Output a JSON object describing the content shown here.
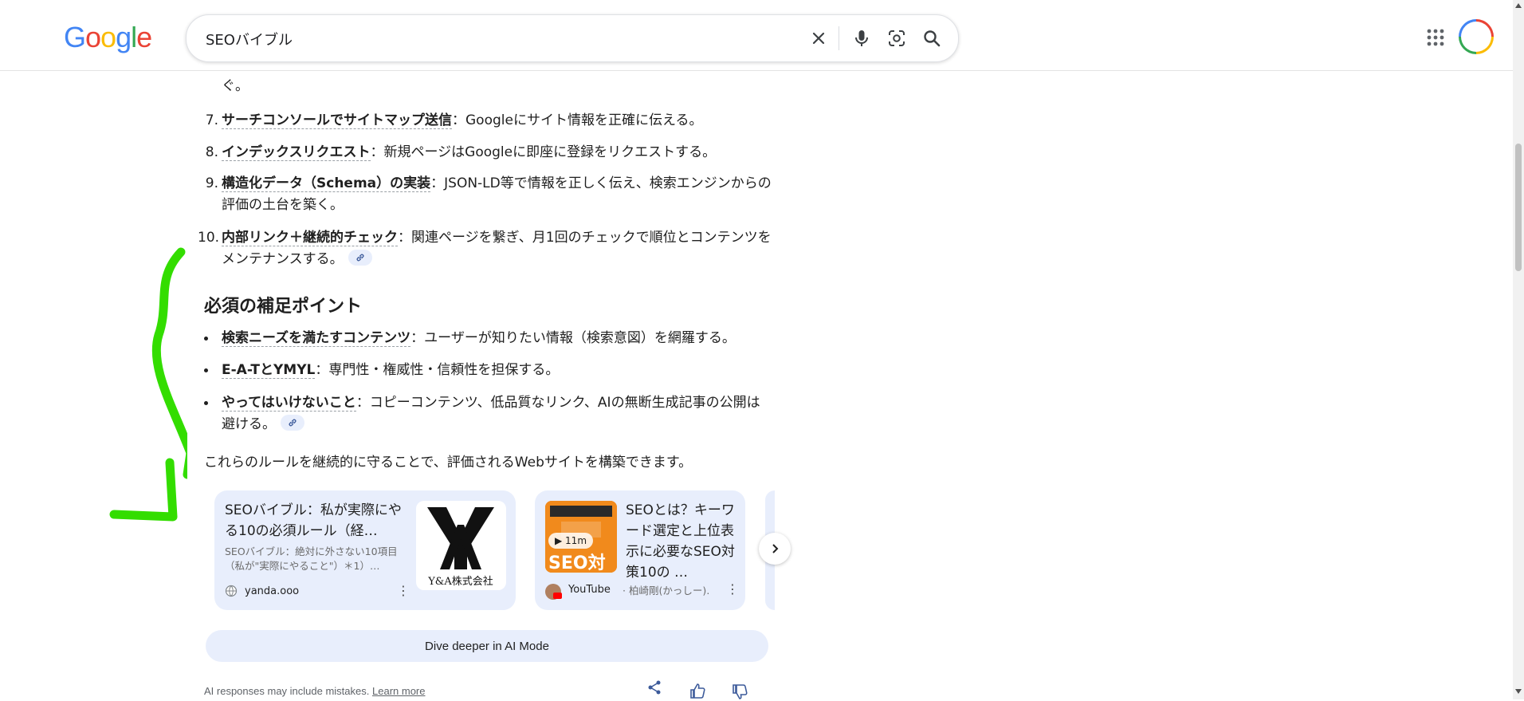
{
  "search": {
    "query": "SEOバイブル"
  },
  "logo": {
    "text": "Google",
    "colors": [
      "#4285f4",
      "#ea4335",
      "#fbbc05",
      "#4285f4",
      "#34a853",
      "#ea4335"
    ]
  },
  "list": {
    "clipped_line": "ぐ。",
    "items": [
      {
        "num": "7.",
        "bold": "サーチコンソールでサイトマップ送信",
        "text": "：Googleにサイト情報を正確に伝える。"
      },
      {
        "num": "8.",
        "bold": "インデックスリクエスト",
        "text": "：新規ページはGoogleに即座に登録をリクエストする。"
      },
      {
        "num": "9.",
        "bold": "構造化データ（Schema）の実装",
        "text": "：JSON-LD等で情報を正しく伝え、検索エンジンからの評価の土台を築く。"
      },
      {
        "num": "10.",
        "bold": "内部リンク＋継続的チェック",
        "text": "：関連ページを繋ぎ、月1回のチェックで順位とコンテンツをメンテナンスする。"
      }
    ]
  },
  "section": {
    "heading": "必須の補足ポイント",
    "bullets": [
      {
        "bold": "検索ニーズを満たすコンテンツ",
        "text": "：ユーザーが知りたい情報（検索意図）を網羅する。"
      },
      {
        "bold": "E-A-TとYMYL",
        "text": "：専門性・権威性・信頼性を担保する。"
      },
      {
        "bold": "やってはいけないこと",
        "text": "：コピーコンテンツ、低品質なリンク、AIの無断生成記事の公開は避ける。"
      }
    ],
    "summary": "これらのルールを継続的に守ることで、評価されるWebサイトを構築できます。"
  },
  "cards": [
    {
      "title": "SEOバイブル：私が実際にやる10の必須ルール（経…",
      "snippet": "SEOバイブル：絶対に外さない10項目（私が\"実際にやること\"）＊1）…",
      "source": "yanda.ooo",
      "thumb_caption": "Y&A株式会社"
    },
    {
      "title": "SEOとは？キーワード選定と上位表示に必要なSEO対策10の …",
      "duration": "11m",
      "source": "YouTube",
      "author": "· 柏崎剛(かっしー)…",
      "thumb_text": "SEO対"
    }
  ],
  "dive_button": "Dive deeper in AI Mode",
  "footer": {
    "disclaimer": "AI responses may include mistakes.",
    "learn_more": "Learn more"
  },
  "colors": {
    "accent_bg": "#e8eefc",
    "annotation": "#33dd00"
  }
}
